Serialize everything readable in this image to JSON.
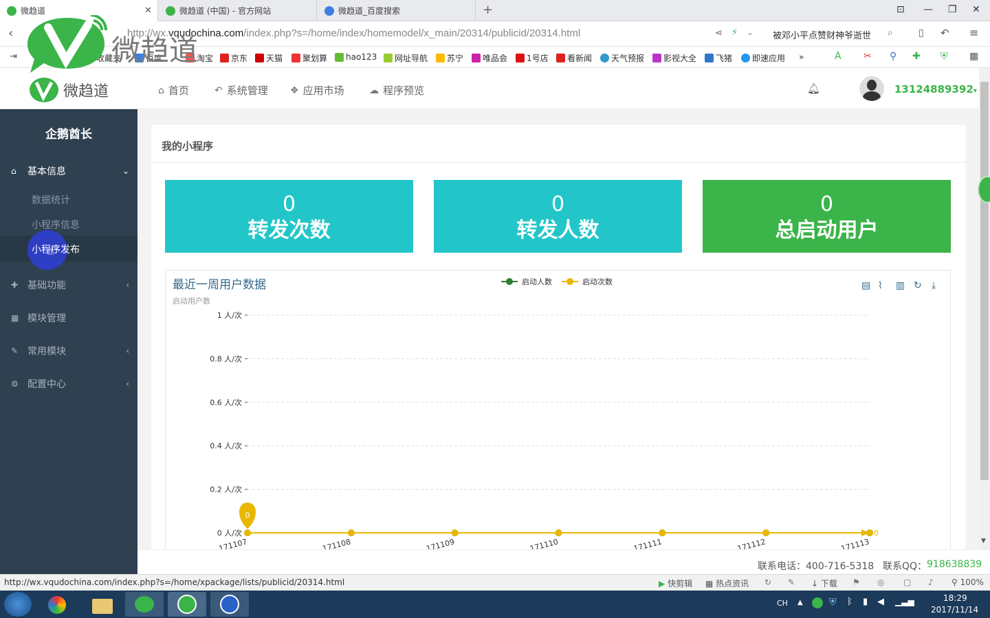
{
  "browser": {
    "tabs": [
      {
        "title": "微趋道",
        "active": true
      },
      {
        "title": "微趋道 (中国) - 官方网站",
        "active": false
      },
      {
        "title": "微趋道_百度搜索",
        "active": false
      }
    ],
    "new_tab": "+",
    "url_prefix": "http://wx.",
    "url_domain": "vqudochina.com",
    "url_path": "/index.php?s=/home/index/homemodel/x_main/20314/publicid/20314.html",
    "search_text": "被邓小平点赞财神爷逝世",
    "bookmarks": [
      "收藏夹",
      "百度",
      "淘宝",
      "京东",
      "天猫",
      "聚划算",
      "hao123",
      "网址导航",
      "苏宁",
      "唯品会",
      "1号店",
      "看新闻",
      "天气预报",
      "影视大全",
      "飞猪",
      "即速应用"
    ],
    "more": "»",
    "status_url": "http://wx.vqudochina.com/index.php?s=/home/xpackage/lists/publicid/20314.html",
    "status_tools": [
      "快剪辑",
      "热点资讯",
      "下载"
    ],
    "zoom": "100%"
  },
  "overlay_logo_text": "微趋道",
  "app": {
    "logo_text": "微趋道",
    "nav": [
      {
        "icon": "home-icon",
        "glyph": "⌂",
        "label": "首页"
      },
      {
        "icon": "reply-icon",
        "glyph": "↶",
        "label": "系统管理"
      },
      {
        "icon": "cubes-icon",
        "glyph": "❖",
        "label": "应用市场"
      },
      {
        "icon": "wechat-icon",
        "glyph": "☁",
        "label": "程序预览"
      }
    ],
    "username": "13124889392",
    "account_name": "企鹅酋长"
  },
  "sidebar": {
    "groups": [
      {
        "label": "基本信息",
        "glyph": "⌂",
        "arrow": "⌄"
      },
      {
        "label": "基础功能",
        "glyph": "✚",
        "arrow": "‹"
      },
      {
        "label": "模块管理",
        "glyph": "▦",
        "arrow": ""
      },
      {
        "label": "常用模块",
        "glyph": "✎",
        "arrow": "‹"
      },
      {
        "label": "配置中心",
        "glyph": "⚙",
        "arrow": "‹"
      }
    ],
    "sub_items": [
      "数据统计",
      "小程序信息",
      "小程序发布"
    ]
  },
  "panel": {
    "title": "我的小程序",
    "cards": [
      {
        "value": "0",
        "label": "转发次数",
        "color": "#23c6c8"
      },
      {
        "value": "0",
        "label": "转发人数",
        "color": "#23c6c8"
      },
      {
        "value": "0",
        "label": "总启动用户",
        "color": "#3bb44a"
      }
    ]
  },
  "chart_data": {
    "type": "line",
    "title": "最近一周用户数据",
    "subtitle": "启动用户数",
    "x": [
      "20171107",
      "20171108",
      "20171109",
      "20171110",
      "20171111",
      "20171112",
      "20171113"
    ],
    "x_labels_visible": [
      "171107",
      "171108",
      "171109",
      "171110",
      "171111",
      "171112",
      "171113"
    ],
    "series": [
      {
        "name": "启动人数",
        "color": "#2e7d32",
        "values": [
          0,
          0,
          0,
          0,
          0,
          0,
          0
        ]
      },
      {
        "name": "启动次数",
        "color": "#e8b800",
        "values": [
          0,
          0,
          0,
          0,
          0,
          0,
          0
        ]
      }
    ],
    "y_ticks": [
      "1 人/次",
      "0.8 人/次",
      "0.6 人/次",
      "0.4 人/次",
      "0.2 人/次",
      "0 人/次"
    ],
    "ylim": [
      0,
      1
    ],
    "grid": true,
    "legend_position": "top-center",
    "pin_label": "0",
    "end_label": "0"
  },
  "footer": {
    "phone_label": "联系电话：400-716-5318",
    "qq_label": "联系QQ：",
    "qq_value": "918638839"
  },
  "taskbar": {
    "lang": "CH",
    "time": "18:29",
    "date": "2017/11/14"
  },
  "colors": {
    "sidebar_bg": "#2f4050",
    "accent_green": "#3bb44a",
    "teal": "#23c6c8"
  }
}
